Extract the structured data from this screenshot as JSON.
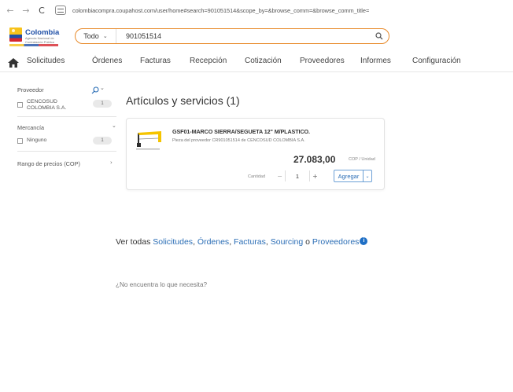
{
  "browser": {
    "back": "←",
    "forward": "→",
    "reload": "C",
    "url": "colombiacompra.coupahost.com/user/home#search=901051514&scope_by=&browse_comm=&browse_comm_title="
  },
  "header": {
    "logo_text": "Colombia",
    "logo_sub": "Agencia Nacional de Contratación Pública",
    "scope": "Todo",
    "search_value": "901051514"
  },
  "nav": {
    "items": [
      "Solicitudes",
      "Órdenes",
      "Facturas",
      "Recepción",
      "Cotización",
      "Proveedores",
      "Informes",
      "Configuración"
    ]
  },
  "facets": {
    "supplier_title": "Proveedor",
    "supplier_option_1": "CENCOSUD",
    "supplier_option_2": "COLOMBIA S.A.",
    "supplier_count": "1",
    "commodity_title": "Mercancía",
    "commodity_option": "Ninguno",
    "commodity_count": "1",
    "price_title": "Rango de precios (COP)"
  },
  "results": {
    "title": "Artículos y servicios (1)",
    "item": {
      "name": "GSF01-MARCO SIERRA/SEGUETA 12\" M/PLASTICO.",
      "meta": "Pieza del proveedor CR901051514 de CENCOSUD COLOMBIA S.A.",
      "price": "27.083,00",
      "unit": "COP / Unidad",
      "qty_label": "Cantidad",
      "qty": "1",
      "add_label": "Agregar"
    }
  },
  "see_all": {
    "prefix": "Ver todas ",
    "link_1": "Solicitudes",
    "sep_1": ", ",
    "link_2": "Órdenes",
    "sep_2": ", ",
    "link_3": "Facturas",
    "sep_3": ", ",
    "link_4": "Sourcing",
    "sep_4": " o ",
    "link_5": "Proveedores",
    "info": "i"
  },
  "not_found": "¿No encuentra lo que necesita?",
  "colors": {
    "accent": "#e88a2a",
    "link": "#2a6db5",
    "info": "#1f6fc5"
  }
}
